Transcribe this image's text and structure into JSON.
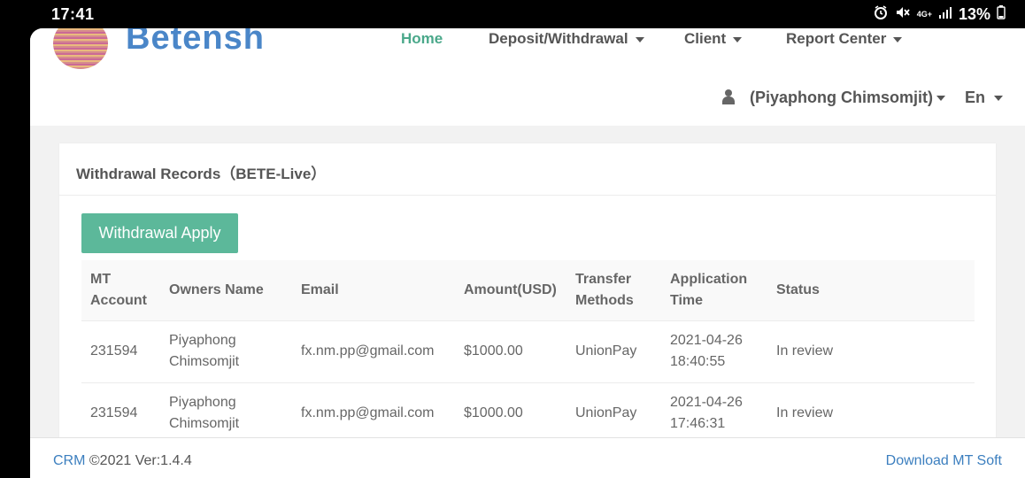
{
  "status_bar": {
    "time": "17:41",
    "network": "4G+",
    "battery": "13%",
    "icons": [
      "alarm-icon",
      "mute-icon",
      "network-4g-icon",
      "signal-icon",
      "battery-icon"
    ]
  },
  "header": {
    "brand": "Betensh",
    "nav": {
      "home": "Home",
      "deposit_withdrawal": "Deposit/Withdrawal",
      "client": "Client",
      "report_center": "Report Center"
    },
    "user_name": "(Piyaphong Chimsomjit)",
    "language": "En"
  },
  "panel": {
    "title": "Withdrawal Records（BETE-Live）",
    "apply_button": "Withdrawal Apply",
    "columns": {
      "mt_account_1": "MT",
      "mt_account_2": "Account",
      "owners_name": "Owners Name",
      "email": "Email",
      "amount": "Amount(USD)",
      "transfer_1": "Transfer",
      "transfer_2": "Methods",
      "time_1": "Application",
      "time_2": "Time",
      "status": "Status"
    },
    "rows": [
      {
        "account": "231594",
        "owner_first": "Piyaphong",
        "owner_last": "Chimsomjit",
        "email": "fx.nm.pp@gmail.com",
        "amount": "$1000.00",
        "method": "UnionPay",
        "date": "2021-04-26",
        "time": "18:40:55",
        "status": "In review"
      },
      {
        "account": "231594",
        "owner_first": "Piyaphong",
        "owner_last": "Chimsomjit",
        "email": "fx.nm.pp@gmail.com",
        "amount": "$1000.00",
        "method": "UnionPay",
        "date": "2021-04-26",
        "time": "17:46:31",
        "status": "In review"
      }
    ]
  },
  "footer": {
    "crm_link": "CRM",
    "copyright": " ©2021 Ver:1.4.4",
    "download_link": "Download MT Soft"
  },
  "colors": {
    "accent_green": "#5cb89a",
    "nav_active": "#4aa88a",
    "brand_blue": "#4a86c8",
    "link_blue": "#3c7fbf"
  }
}
